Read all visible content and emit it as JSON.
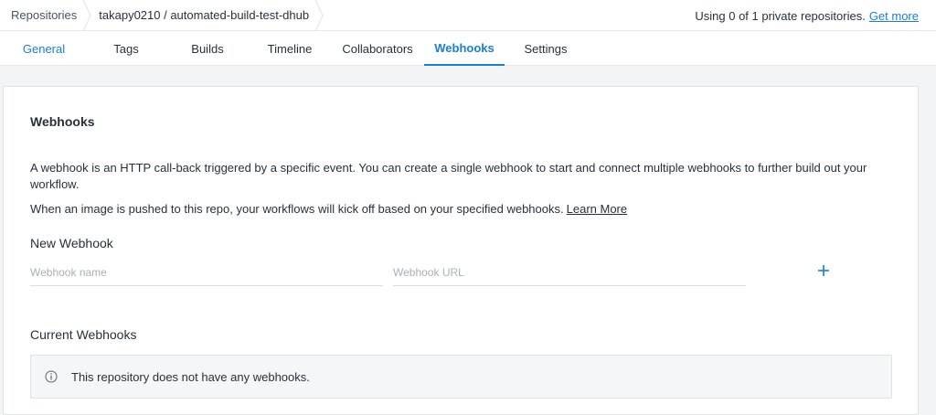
{
  "breadcrumb": {
    "root": "Repositories",
    "repo": "takapy0210 / automated-build-test-dhub"
  },
  "usage": {
    "text": "Using 0 of 1 private repositories.",
    "link": "Get more"
  },
  "tabs": [
    {
      "label": "General"
    },
    {
      "label": "Tags"
    },
    {
      "label": "Builds"
    },
    {
      "label": "Timeline"
    },
    {
      "label": "Collaborators"
    },
    {
      "label": "Webhooks"
    },
    {
      "label": "Settings"
    }
  ],
  "active_tab": "Webhooks",
  "webhooks": {
    "title": "Webhooks",
    "description": "A webhook is an HTTP call-back triggered by a specific event. You can create a single webhook to start and connect multiple webhooks to further build out your workflow.",
    "push_text": "When an image is pushed to this repo, your workflows will kick off based on your specified webhooks.",
    "learn_more": "Learn More",
    "new_title": "New Webhook",
    "name_placeholder": "Webhook name",
    "url_placeholder": "Webhook URL",
    "current_title": "Current Webhooks",
    "empty_message": "This repository does not have any webhooks."
  },
  "colors": {
    "accent": "#1a7dd7",
    "text": "#27313b",
    "background": "#f3f4f5"
  },
  "icons": {
    "add": "plus-icon",
    "info": "info-circle-icon",
    "separator": "chevron-right-icon"
  }
}
